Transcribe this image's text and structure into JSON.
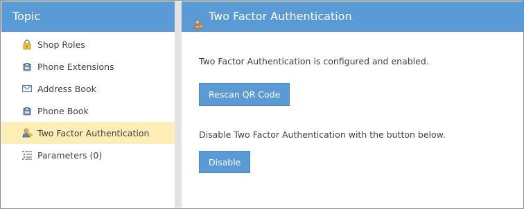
{
  "sidebar": {
    "title": "Topic",
    "items": [
      {
        "label": "Shop Roles",
        "icon": "lock-icon",
        "selected": false
      },
      {
        "label": "Phone Extensions",
        "icon": "phone-icon",
        "selected": false
      },
      {
        "label": "Address Book",
        "icon": "envelope-icon",
        "selected": false
      },
      {
        "label": "Phone Book",
        "icon": "phone-icon",
        "selected": false
      },
      {
        "label": "Two Factor Authentication",
        "icon": "user-key-icon",
        "selected": true
      },
      {
        "label": "Parameters (0)",
        "icon": "list-icon",
        "selected": false
      }
    ]
  },
  "main": {
    "title": "Two Factor Authentication",
    "title_icon": "user-key-icon",
    "status_text": "Two Factor Authentication is configured and enabled.",
    "rescan_label": "Rescan QR Code",
    "disable_text": "Disable Two Factor Authentication with the button below.",
    "disable_label": "Disable"
  },
  "colors": {
    "header_bg": "#5b9bd5",
    "selected_bg": "#fdeeb6",
    "divider": "#e3e3e3",
    "button_bg": "#5b9bd5"
  }
}
